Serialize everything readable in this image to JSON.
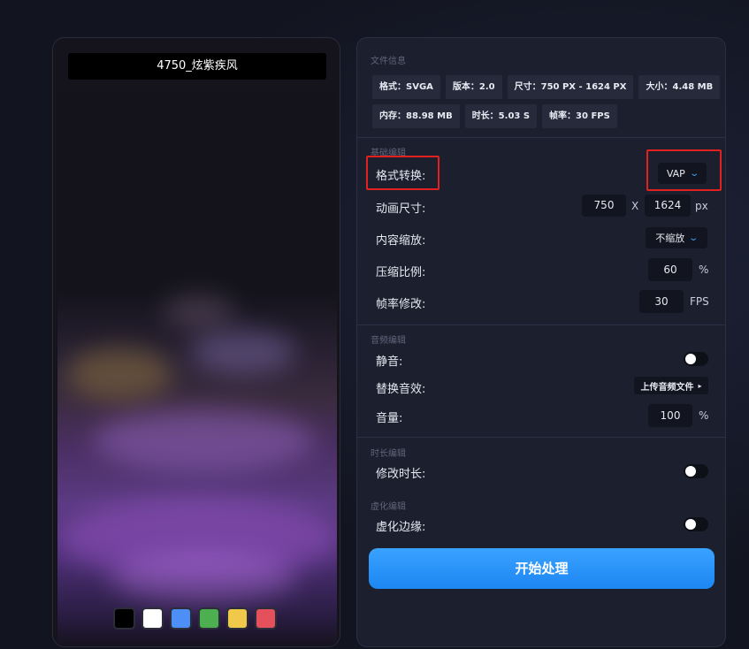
{
  "preview": {
    "title": "4750_炫紫疾风",
    "swatches": [
      "#000000",
      "#ffffff",
      "#4d8ef7",
      "#4caf50",
      "#f0c94a",
      "#e4505b"
    ]
  },
  "file_info": {
    "section": "文件信息",
    "tags_row1": [
      "格式：SVGA",
      "版本：2.0",
      "尺寸：750 PX - 1624 PX",
      "大小：4.48 MB"
    ],
    "tags_row2": [
      "内存：88.98 MB",
      "时长：5.03 S",
      "帧率：30 FPS"
    ]
  },
  "basic_edit": {
    "section": "基础编辑",
    "format_label": "格式转换:",
    "format_value": "VAP",
    "size_label": "动画尺寸:",
    "width": "750",
    "times": "X",
    "height": "1624",
    "size_unit": "px",
    "scale_label": "内容缩放:",
    "scale_value": "不缩放",
    "compress_label": "压缩比例:",
    "compress_value": "60",
    "compress_unit": "%",
    "fps_label": "帧率修改:",
    "fps_value": "30",
    "fps_unit": "FPS"
  },
  "audio_edit": {
    "section": "音频编辑",
    "mute_label": "静音:",
    "mute_on": false,
    "replace_label": "替换音效:",
    "upload_label": "上传音频文件",
    "volume_label": "音量:",
    "volume_value": "100",
    "volume_unit": "%"
  },
  "duration_edit": {
    "section": "时长编辑",
    "modify_label": "修改时长:",
    "modify_on": false
  },
  "blur_edit": {
    "section": "虚化编辑",
    "edge_label": "虚化边缘:",
    "edge_on": false
  },
  "start_button": "开始处理",
  "colors": {
    "accent": "#3aa2ff",
    "highlight": "#e0211f",
    "panel": "#1c1f2e"
  }
}
